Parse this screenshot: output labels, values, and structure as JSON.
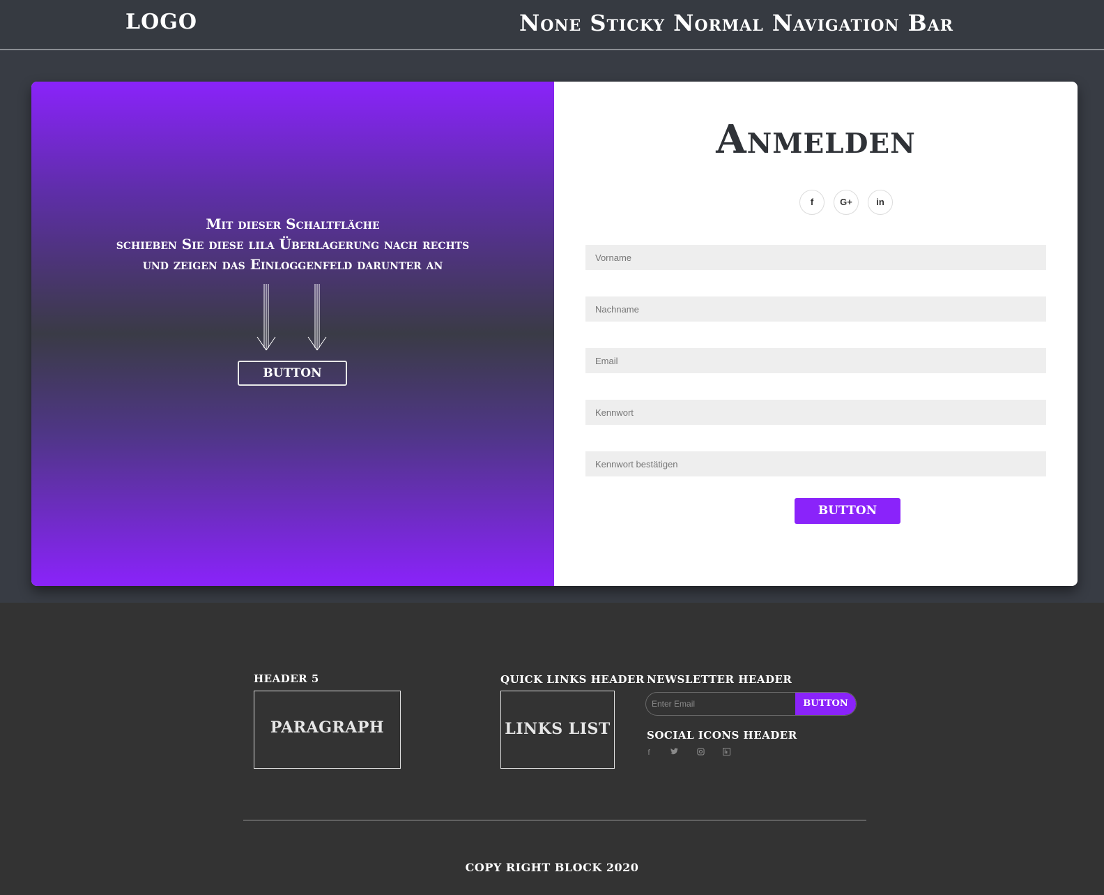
{
  "navbar": {
    "logo": "LOGO",
    "title": "None Sticky Normal Navigation Bar"
  },
  "overlay": {
    "lines": [
      "Mit dieser Schaltfläche",
      "schieben Sie diese lila Überlagerung nach rechts",
      "und zeigen das Einloggenfeld darunter an"
    ],
    "button_label": "BUTTON"
  },
  "signup": {
    "title": "Anmelden",
    "social": [
      {
        "icon": "facebook-icon",
        "glyph": "f"
      },
      {
        "icon": "google-plus-icon",
        "glyph": "G+"
      },
      {
        "icon": "linkedin-icon",
        "glyph": "in"
      }
    ],
    "fields": [
      {
        "placeholder": "Vorname",
        "value": ""
      },
      {
        "placeholder": "Nachname",
        "value": ""
      },
      {
        "placeholder": "Email",
        "value": ""
      },
      {
        "placeholder": "Kennwort",
        "value": ""
      },
      {
        "placeholder": "Kennwort bestätigen",
        "value": ""
      }
    ],
    "submit_label": "BUTTON"
  },
  "footer": {
    "col1_header": "HEADER 5",
    "col1_body": "PARAGRAPH",
    "col2_header": "QUICK LINKS HEADER",
    "col2_body": "LINKS LIST",
    "newsletter_header": "NEWSLETTER HEADER",
    "newsletter_placeholder": "Enter Email",
    "newsletter_button": "BUTTON",
    "social_header": "SOCIAL ICONS HEADER",
    "social_icons": [
      {
        "icon": "facebook-icon",
        "glyph": "f"
      },
      {
        "icon": "twitter-icon",
        "glyph": "♥"
      },
      {
        "icon": "instagram-icon",
        "glyph": "◎"
      },
      {
        "icon": "linkedin-icon",
        "glyph": "▣"
      }
    ],
    "copyright": "COPY RIGHT BLOCK 2020"
  },
  "colors": {
    "accent": "#8a23fa",
    "background": "#373b42",
    "footer": "#333333",
    "card": "#ffffff"
  }
}
